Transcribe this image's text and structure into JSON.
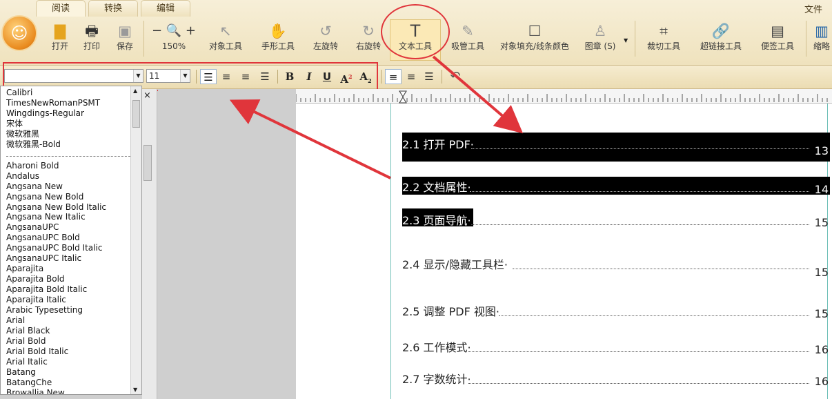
{
  "tabs": [
    {
      "label": "阅读",
      "active": true
    },
    {
      "label": "转换",
      "active": false
    },
    {
      "label": "编辑",
      "active": false
    }
  ],
  "file_menu": "文件",
  "toolbar": {
    "open": "打开",
    "print": "打印",
    "save": "保存",
    "zoom": "150%",
    "object_tool": "对象工具",
    "hand_tool": "手形工具",
    "rotate_left": "左旋转",
    "rotate_right": "右旋转",
    "text_tool": "文本工具",
    "eyedropper": "吸管工具",
    "fill_stroke": "对象填充/线条颜色",
    "stamp": "图章 (S)",
    "crop": "裁切工具",
    "link": "超链接工具",
    "note": "便签工具",
    "more": "缩略"
  },
  "format": {
    "font_value": "",
    "size_value": "11",
    "bold": "B",
    "italic": "I",
    "underline": "U",
    "superscript": "A",
    "subscript": "A"
  },
  "font_list": {
    "recent": [
      "Calibri",
      "TimesNewRomanPSMT",
      "Wingdings-Regular",
      "宋体",
      "微软雅黑",
      "微软雅黑-Bold"
    ],
    "all": [
      "Aharoni Bold",
      "Andalus",
      "Angsana New",
      "Angsana New Bold",
      "Angsana New Bold Italic",
      "Angsana New Italic",
      "AngsanaUPC",
      "AngsanaUPC Bold",
      "AngsanaUPC Bold Italic",
      "AngsanaUPC Italic",
      "Aparajita",
      "Aparajita Bold",
      "Aparajita Bold Italic",
      "Aparajita Italic",
      "Arabic Typesetting",
      "Arial",
      "Arial Black",
      "Arial Bold",
      "Arial Bold Italic",
      "Arial Italic",
      "Batang",
      "BatangChe",
      "Browallia New"
    ]
  },
  "side_close": "×",
  "toc": [
    {
      "title": "2.1 打开 PDF·",
      "page": "13",
      "selected": true
    },
    {
      "title": "2.2 文档属性·",
      "page": "14",
      "selected": true
    },
    {
      "title": "2.3 页面导航·",
      "page": "15",
      "selected": true
    },
    {
      "title": "2.4 显示/隐藏工具栏·",
      "page": "15",
      "selected": false
    },
    {
      "title": "2.5 调整 PDF 视图·",
      "page": "15",
      "selected": false
    },
    {
      "title": "2.6 工作模式·",
      "page": "16",
      "selected": false
    },
    {
      "title": "2.7 字数统计·",
      "page": "16",
      "selected": false
    }
  ],
  "colors": {
    "highlight": "#e0353b",
    "selection": "#000000",
    "frame": "#6fc0b7"
  }
}
